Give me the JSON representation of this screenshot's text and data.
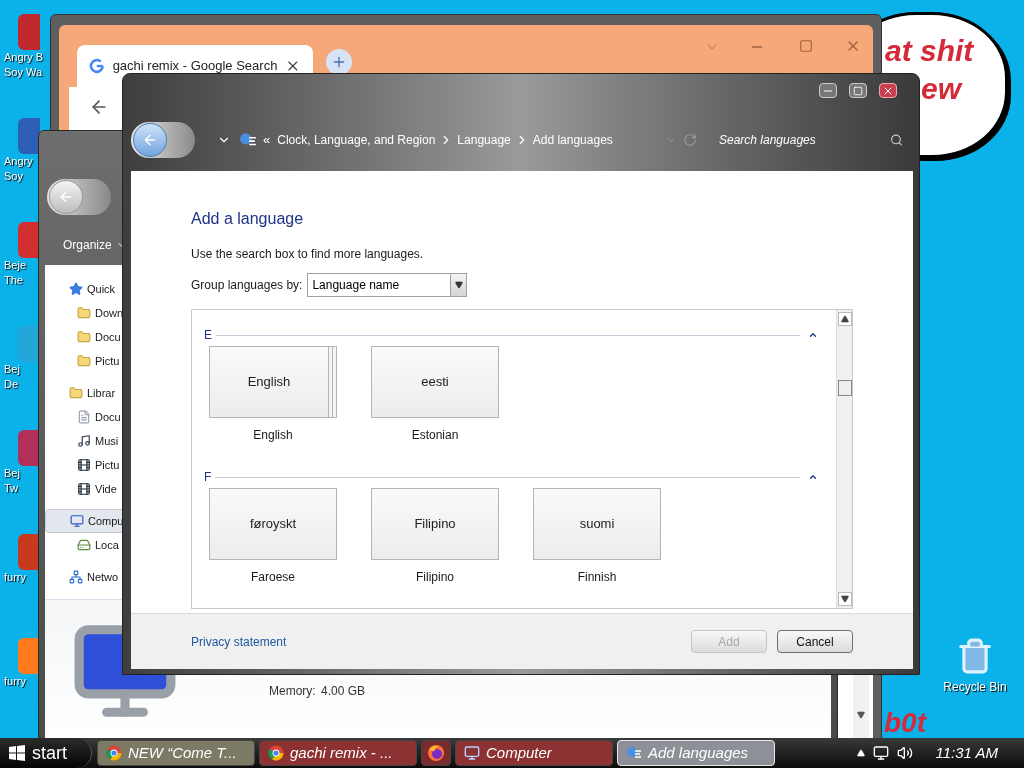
{
  "desktop_icons": [
    {
      "lines": [
        "Angry B",
        "Soy Wa"
      ]
    },
    {
      "lines": [
        "Angry",
        "Soy"
      ]
    },
    {
      "lines": [
        "Beje",
        "The"
      ]
    },
    {
      "lines": [
        "Bej",
        "De"
      ]
    },
    {
      "lines": [
        "Bej",
        "Tw"
      ]
    },
    {
      "lines": [
        "furry"
      ]
    },
    {
      "lines": [
        "furry"
      ]
    }
  ],
  "recycle_bin": {
    "label": "Recycle Bin"
  },
  "wallpaper": {
    "bubble_lines": [
      "at shit",
      "ew"
    ],
    "corner_text": "b0t"
  },
  "browser": {
    "tab_title": "gachi remix - Google Search"
  },
  "explorer": {
    "toolbar": "Organize",
    "nav": [
      {
        "label": "Quick",
        "kind": "star",
        "selected": false,
        "children": [
          {
            "label": "Down",
            "kind": "folder",
            "selected": false
          },
          {
            "label": "Docu",
            "kind": "folder",
            "selected": false
          },
          {
            "label": "Pictu",
            "kind": "folder",
            "selected": false
          }
        ]
      },
      {
        "label": "Librar",
        "kind": "folder",
        "selected": false,
        "children": [
          {
            "label": "Docu",
            "kind": "document",
            "selected": false
          },
          {
            "label": "Musi",
            "kind": "music",
            "selected": false
          },
          {
            "label": "Pictu",
            "kind": "film",
            "selected": false
          },
          {
            "label": "Vide",
            "kind": "film",
            "selected": false
          }
        ]
      },
      {
        "label": "Compu",
        "kind": "computer",
        "selected": true,
        "children": [
          {
            "label": "Loca",
            "kind": "drive",
            "selected": false
          }
        ]
      },
      {
        "label": "Netwo",
        "kind": "network",
        "selected": false
      }
    ],
    "details": {
      "label": "Memory:",
      "value": "4.00 GB"
    }
  },
  "dialog": {
    "breadcrumb_overflow": "«",
    "breadcrumb": [
      "Clock, Language, and Region",
      "Language",
      "Add languages"
    ],
    "search": {
      "placeholder": "Search languages"
    },
    "heading": "Add a language",
    "hint": "Use the search box to find more languages.",
    "group_by": {
      "label": "Group languages by:",
      "value": "Language name"
    },
    "groups": [
      {
        "letter": "E",
        "expanded": true,
        "languages": [
          {
            "native": "English",
            "name": "English",
            "variants": true
          },
          {
            "native": "eesti",
            "name": "Estonian",
            "variants": false
          }
        ]
      },
      {
        "letter": "F",
        "expanded": true,
        "languages": [
          {
            "native": "føroyskt",
            "name": "Faroese",
            "variants": false
          },
          {
            "native": "Filipino",
            "name": "Filipino",
            "variants": false
          },
          {
            "native": "suomi",
            "name": "Finnish",
            "variants": false
          }
        ]
      }
    ],
    "privacy_link": "Privacy statement",
    "buttons": [
      {
        "label": "Add",
        "disabled": true
      },
      {
        "label": "Cancel",
        "disabled": false
      }
    ]
  },
  "taskbar": {
    "start": "start",
    "tasks": [
      {
        "label": "NEW “Come T...",
        "kind": "chrome",
        "color": "#7c7a64",
        "selected": false
      },
      {
        "label": "gachi remix - ...",
        "kind": "chrome",
        "color": "#8c3232",
        "selected": false
      },
      {
        "kind": "firefox",
        "color": "#7a2c2c",
        "selected": false
      },
      {
        "label": "Computer",
        "kind": "computer",
        "color": "#8c3232",
        "selected": false
      },
      {
        "label": "Add languages",
        "kind": "language",
        "color": "#8d9096",
        "selected": true
      }
    ],
    "clock": "11:31 AM"
  }
}
